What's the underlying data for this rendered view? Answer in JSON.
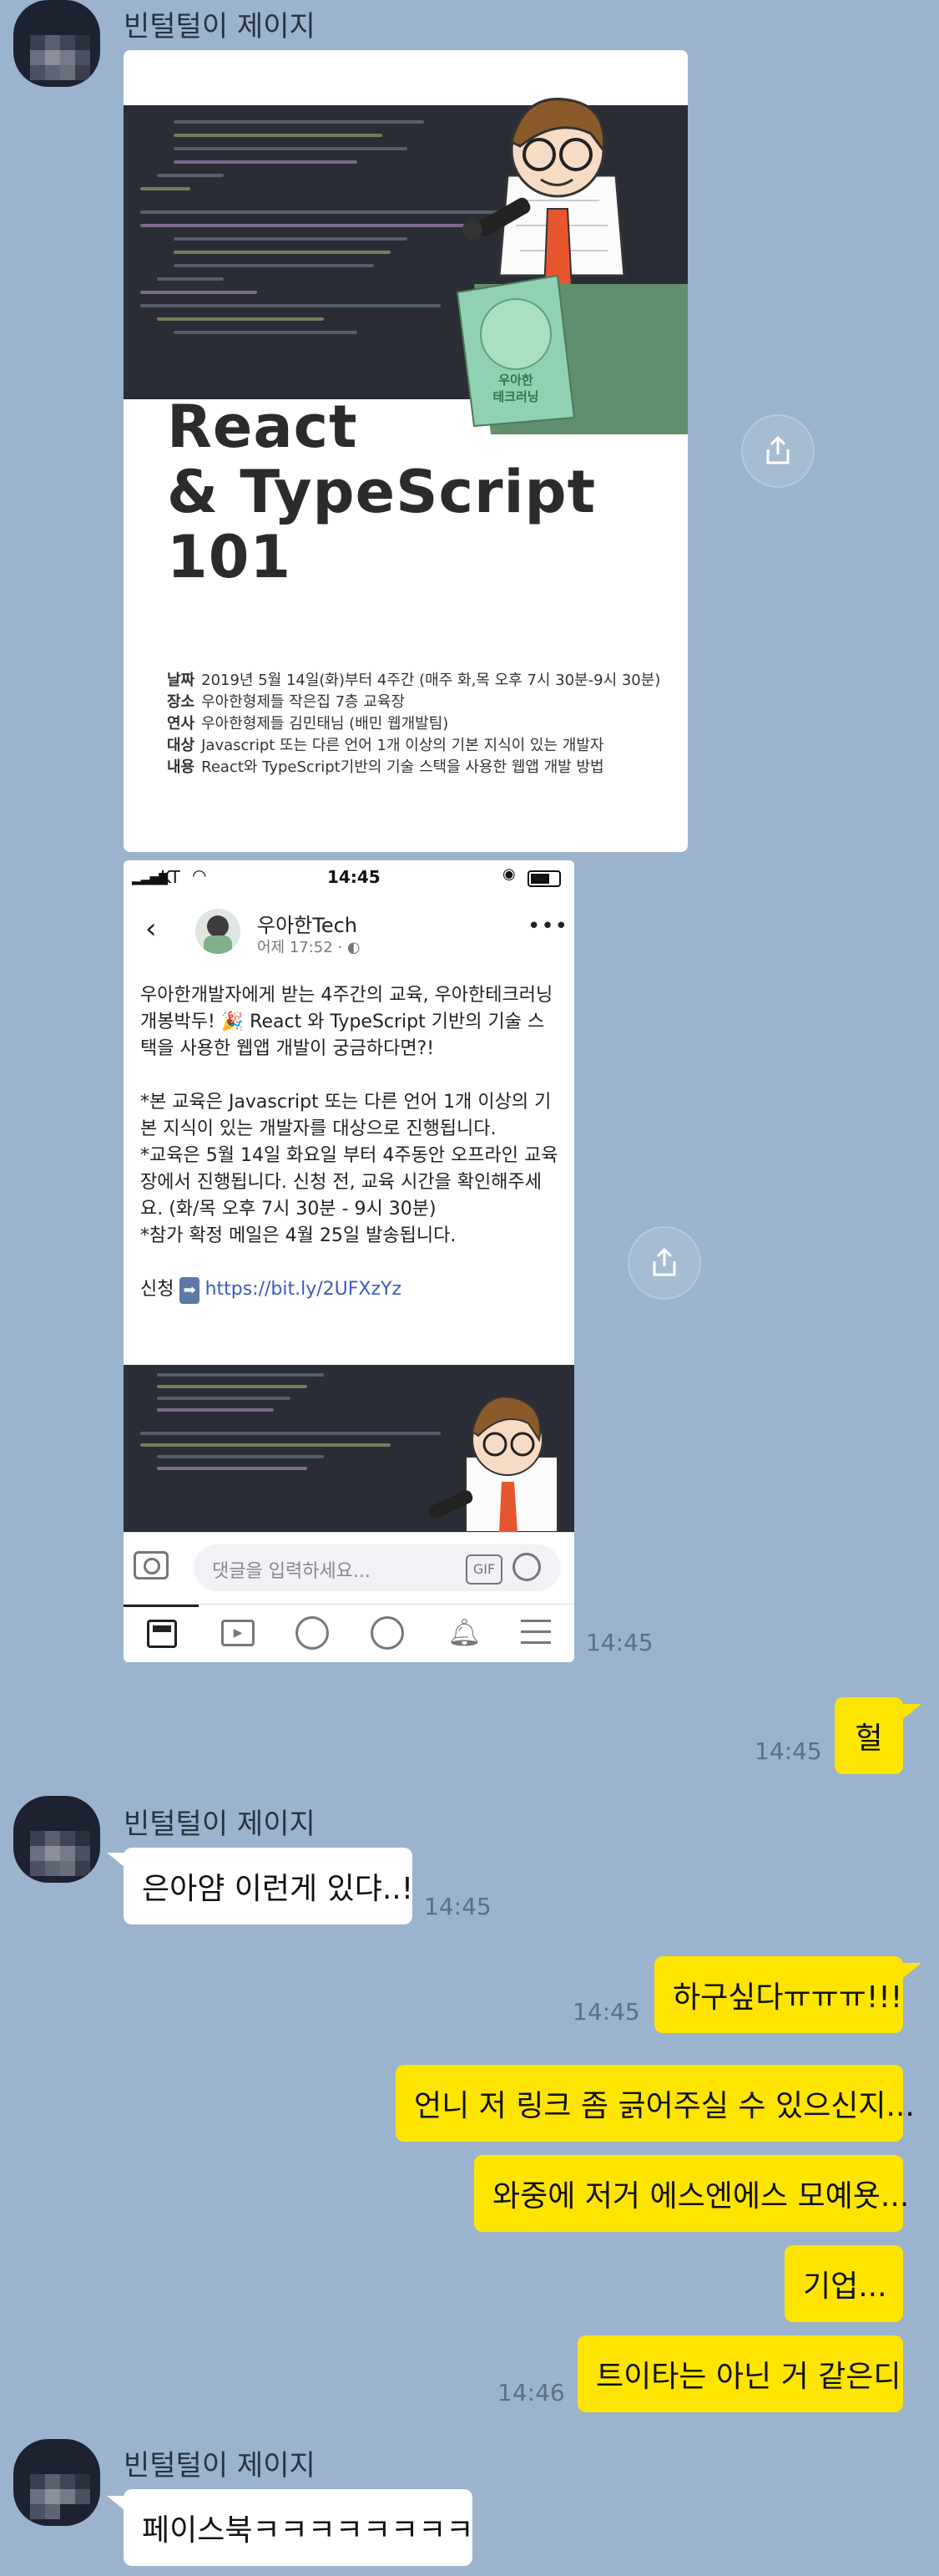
{
  "chat": {
    "sender_name": "빈털털이 제이지",
    "link_emoji": "➡️",
    "party_emoji": "🎉"
  },
  "poster": {
    "title_line1": "React",
    "title_line2": "& TypeScript 101",
    "badge_line1": "우아한",
    "badge_line2": "테크러닝",
    "info": [
      {
        "label": "날짜",
        "text": "2019년 5월 14일(화)부터 4주간 (매주 화,목 오후 7시 30분-9시 30분)"
      },
      {
        "label": "장소",
        "text": "우아한형제들 작은집 7층 교육장"
      },
      {
        "label": "연사",
        "text": "우아한형제들 김민태님 (배민 웹개발팀)"
      },
      {
        "label": "대상",
        "text": "Javascript 또는 다른 언어 1개 이상의 기본 지식이 있는 개발자"
      },
      {
        "label": "내용",
        "text": "React와 TypeScript기반의 기술 스택을 사용한 웹앱 개발 방법"
      }
    ]
  },
  "phone": {
    "carrier": "KT",
    "clock": "14:45",
    "page_name": "우아한Tech",
    "post_time": "어제 17:52 · ",
    "post_lines": [
      "우아한개발자에게 받는 4주간의 교육, 우아한테크러닝",
      "개봉박두! 🎉 React 와 TypeScript 기반의 기술 스",
      "택을 사용한 웹앱 개발이 궁금하다면?!",
      "",
      "*본 교육은 Javascript 또는 다른 언어 1개 이상의 기",
      "본 지식이 있는 개발자를 대상으로 진행됩니다.",
      "*교육은 5월 14일 화요일 부터 4주동안 오프라인 교육",
      "장에서 진행됩니다. 신청 전, 교육 시간을 확인해주세",
      "요. (화/목 오후 7시 30분 - 9시 30분)",
      "*참가 확정 메일은 4월 25일 발송됩니다."
    ],
    "apply_label": "신청",
    "apply_link": "https://bit.ly/2UFXzYz",
    "comment_placeholder": "댓글을 입력하세요...",
    "gif_label": "GIF"
  },
  "messages": {
    "phone_time": "14:45",
    "m1_text": "헐",
    "m1_time": "14:45",
    "m2_text": "은아얌 이런게 있댜..!",
    "m2_time": "14:45",
    "m3_text": "하구싶다ㅠㅠㅠ!!!",
    "m3_time": "14:45",
    "m4_text": "언니 저 링크 좀 긁어주실 수 있으신지...",
    "m5_text": "와중에 저거 에스엔에스 모예욧...",
    "m6_text": "기업...",
    "m7_text": "트이타는 아닌 거 같은디",
    "m7_time": "14:46",
    "m8_text": "페이스북ㅋㅋㅋㅋㅋㅋㅋㅋ"
  }
}
